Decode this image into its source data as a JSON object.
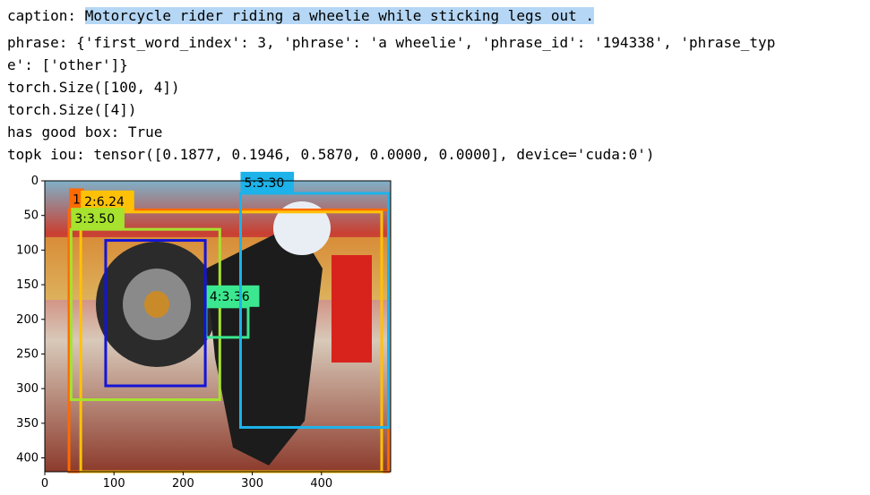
{
  "output": {
    "caption_label": "caption: ",
    "caption_text": "Motorcycle rider riding a wheelie while sticking legs out .",
    "phrase_line1": "phrase: {'first_word_index': 3, 'phrase': 'a wheelie', 'phrase_id': '194338', 'phrase_typ",
    "phrase_line2": "e': ['other']}",
    "size1": "torch.Size([100, 4])",
    "size2": "torch.Size([4])",
    "good_box": "has good box: True",
    "topk": "topk iou: tensor([0.1877, 0.1946, 0.5870, 0.0000, 0.0000], device='cuda:0')"
  },
  "plot": {
    "x_ticks": [
      "0",
      "100",
      "200",
      "300",
      "400"
    ],
    "y_ticks": [
      "0",
      "50",
      "100",
      "150",
      "200",
      "250",
      "300",
      "350",
      "400"
    ],
    "image_extent": {
      "x": [
        0,
        500
      ],
      "y": [
        0,
        420
      ]
    },
    "boxes": [
      {
        "label": "1",
        "color": "#ff6a00",
        "x1": 35,
        "y1": 42,
        "x2": 497,
        "y2": 420
      },
      {
        "label": "2:6.24",
        "color": "#ffc107",
        "x1": 52,
        "y1": 45,
        "x2": 487,
        "y2": 420
      },
      {
        "label": "3:3.50",
        "color": "#a6e22e",
        "x1": 38,
        "y1": 70,
        "x2": 253,
        "y2": 316
      },
      {
        "label": "4:3.36",
        "color": "#3be88f",
        "x1": 233,
        "y1": 182,
        "x2": 294,
        "y2": 226
      },
      {
        "label": "5:3.30",
        "color": "#1db3ea",
        "x1": 283,
        "y1": 18,
        "x2": 497,
        "y2": 356
      },
      {
        "label": "",
        "color": "#1414d6",
        "x1": 88,
        "y1": 86,
        "x2": 232,
        "y2": 296
      }
    ]
  }
}
